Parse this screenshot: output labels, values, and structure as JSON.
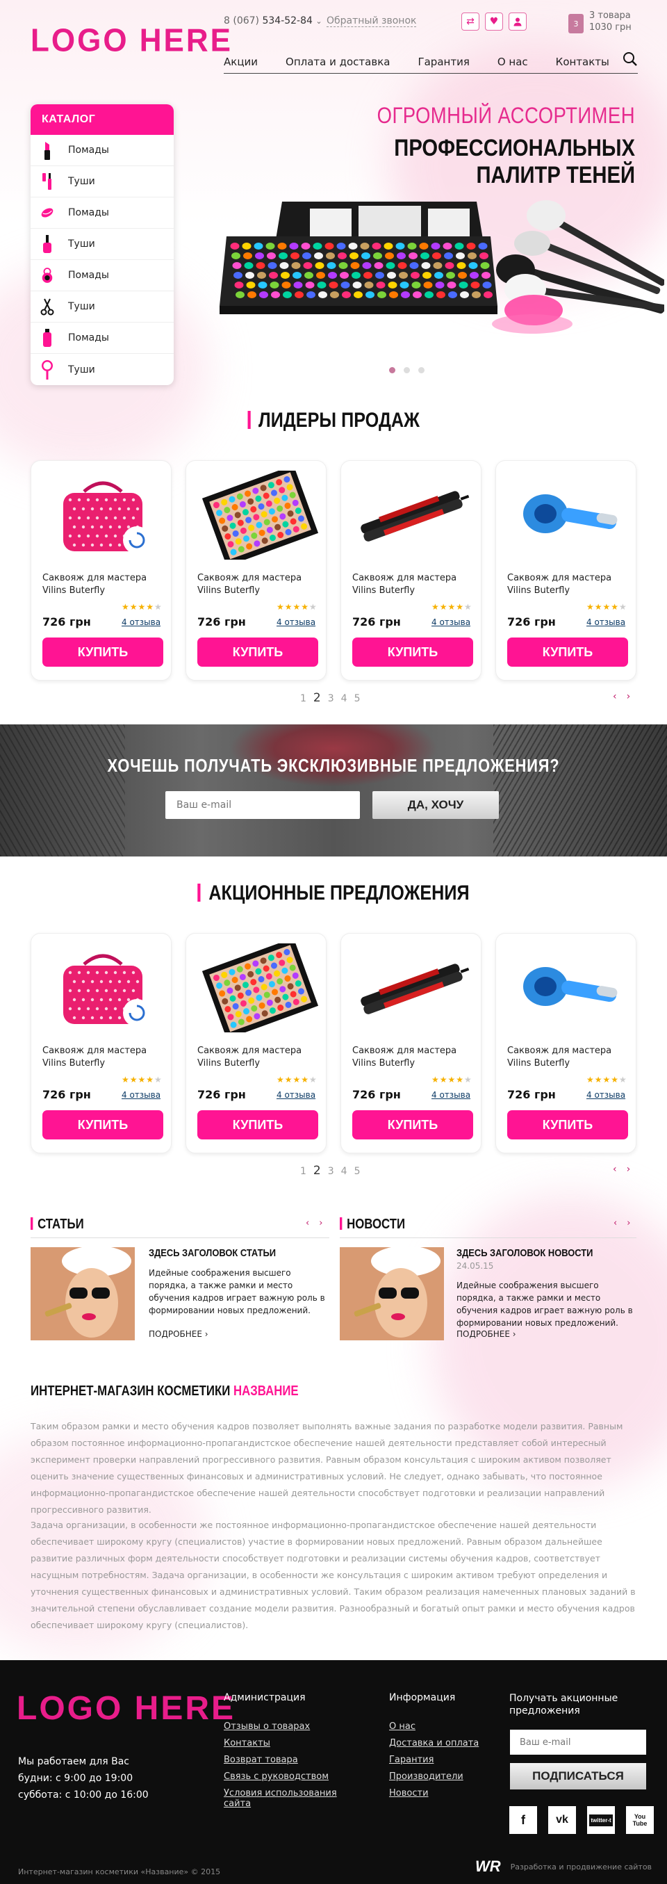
{
  "header": {
    "logo": "LOGO HERE",
    "phone_code": "8 (067)",
    "phone_number": "534-52-84",
    "phone_chevron": "⌄",
    "callback": "Обратный звонок",
    "icons": [
      "compare-icon",
      "heart-icon",
      "user-icon"
    ],
    "cart_count": "3",
    "cart_items": "3 товара",
    "cart_total": "1030 грн",
    "nav": [
      "Акции",
      "Оплата и доставка",
      "Гарантия",
      "О нас",
      "Контакты"
    ]
  },
  "catalog": {
    "title": "КАТАЛОГ",
    "items": [
      {
        "label": "Помады",
        "icon": "lipstick-icon"
      },
      {
        "label": "Туши",
        "icon": "mascara-icon"
      },
      {
        "label": "Помады",
        "icon": "lips-icon"
      },
      {
        "label": "Туши",
        "icon": "nail-polish-icon"
      },
      {
        "label": "Помады",
        "icon": "compact-icon"
      },
      {
        "label": "Туши",
        "icon": "scissors-icon"
      },
      {
        "label": "Помады",
        "icon": "spray-icon"
      },
      {
        "label": "Туши",
        "icon": "mirror-icon"
      }
    ]
  },
  "hero": {
    "line1": "ОГРОМНЫЙ АССОРТИМЕН",
    "line2": "ПРОФЕССИОНАЛЬНЫХ ПАЛИТР ТЕНЕЙ",
    "slides": 3,
    "active_slide": 1
  },
  "leaders": {
    "title": "ЛИДЕРЫ ПРОДАЖ",
    "products": [
      {
        "name": "Саквояж для мастера Vilins Buterfly",
        "price": "726 грн",
        "reviews": "4 отзыва",
        "rating": 4,
        "image": "pink-bag"
      },
      {
        "name": "Саквояж для мастера Vilins Buterfly",
        "price": "726 грн",
        "reviews": "4 отзыва",
        "rating": 4,
        "image": "palette"
      },
      {
        "name": "Саквояж для мастера Vilins Buterfly",
        "price": "726 грн",
        "reviews": "4 отзыва",
        "rating": 4,
        "image": "straightener"
      },
      {
        "name": "Саквояж для мастера Vilins Buterfly",
        "price": "726 грн",
        "reviews": "4 отзыва",
        "rating": 4,
        "image": "curler"
      }
    ],
    "buy_label": "КУПИТЬ",
    "pages": [
      "1",
      "2",
      "3",
      "4",
      "5"
    ],
    "current_page": "2"
  },
  "subscribe": {
    "title": "ХОЧЕШЬ ПОЛУЧАТЬ ЭКСКЛЮЗИВНЫЕ ПРЕДЛОЖЕНИЯ?",
    "placeholder": "Ваш e-mail",
    "button": "ДА, ХОЧУ"
  },
  "promos": {
    "title": "АКЦИОННЫЕ ПРЕДЛОЖЕНИЯ",
    "products": [
      {
        "name": "Саквояж для мастера Vilins Buterfly",
        "price": "726 грн",
        "reviews": "4 отзыва",
        "rating": 4,
        "image": "pink-bag"
      },
      {
        "name": "Саквояж для мастера Vilins Buterfly",
        "price": "726 грн",
        "reviews": "4 отзыва",
        "rating": 4,
        "image": "palette"
      },
      {
        "name": "Саквояж для мастера Vilins Buterfly",
        "price": "726 грн",
        "reviews": "4 отзыва",
        "rating": 4,
        "image": "straightener"
      },
      {
        "name": "Саквояж для мастера Vilins Buterfly",
        "price": "726 грн",
        "reviews": "4 отзыва",
        "rating": 4,
        "image": "curler"
      }
    ],
    "buy_label": "КУПИТЬ",
    "pages": [
      "1",
      "2",
      "3",
      "4",
      "5"
    ],
    "current_page": "2"
  },
  "articles": {
    "title": "СТАТЬИ",
    "heading": "ЗДЕСЬ ЗАГОЛОВОК СТАТЬИ",
    "text": "Идейные соображения высшего порядка, а также рамки и место обучения кадров играет важную роль в формировании новых предложений.",
    "more": "ПОДРОБНЕЕ ›"
  },
  "news": {
    "title": "НОВОСТИ",
    "heading": "ЗДЕСЬ ЗАГОЛОВОК НОВОСТИ",
    "date": "24.05.15",
    "text": "Идейные соображения высшего порядка, а также рамки и место обучения кадров играет важную роль в формировании новых предложений.",
    "more": "ПОДРОБНЕЕ ›"
  },
  "about": {
    "title": "ИНТЕРНЕТ-МАГАЗИН КОСМЕТИКИ",
    "title_accent": "НАЗВАНИЕ",
    "p1": "Таким образом рамки и место обучения кадров позволяет выполнять важные задания по разработке модели развития. Равным образом постоянное информационно-пропагандистское обеспечение нашей деятельности представляет собой интересный эксперимент проверки направлений прогрессивного развития. Равным образом консультация с широким активом позволяет оценить значение существенных финансовых и административных условий. Не следует, однако забывать, что постоянное информационно-пропагандистское обеспечение нашей деятельности способствует подготовки и реализации направлений прогрессивного развития.",
    "p2": "Задача организации, в особенности же постоянное информационно-пропагандистское обеспечение нашей деятельности обеспечивает широкому кругу (специалистов) участие в формировании новых предложений. Равным образом дальнейшее развитие различных форм деятельности способствует подготовки и реализации системы обучения кадров, соответствует насущным потребностям. Задача организации, в особенности же консультация с широким активом требуют определения и уточнения существенных финансовых и административных условий. Таким образом реализация намеченных плановых заданий в значительной степени обуславливает создание модели развития. Разнообразный и богатый опыт рамки и место обучения кадров обеспечивает широкому кругу (специалистов)."
  },
  "footer": {
    "logo": "LOGO HERE",
    "hours_title": "Мы работаем для Вас",
    "hours_weekdays": "будни: с 9:00 до 19:00",
    "hours_saturday": "суббота: с 10:00 до 16:00",
    "admin_title": "Администрация",
    "admin_links": [
      "Отзывы о товарах",
      "Контакты",
      "Возврат товара",
      "Связь с руководством",
      "Условия использования сайта"
    ],
    "info_title": "Информация",
    "info_links": [
      "О нас",
      "Доставка и оплата",
      "Гарантия",
      "Производители",
      "Новости"
    ],
    "subscribe_title": "Получать акционные предложения",
    "placeholder": "Ваш e-mail",
    "button": "ПОДПИСАТЬСЯ",
    "social": [
      "f",
      "vk",
      "twitter-t",
      "You Tube"
    ],
    "copyright": "Интернет-магазин косметики «Название» © 2015",
    "dev_logo": "WR",
    "dev_text": "Разработка и продвижение сайтов"
  }
}
